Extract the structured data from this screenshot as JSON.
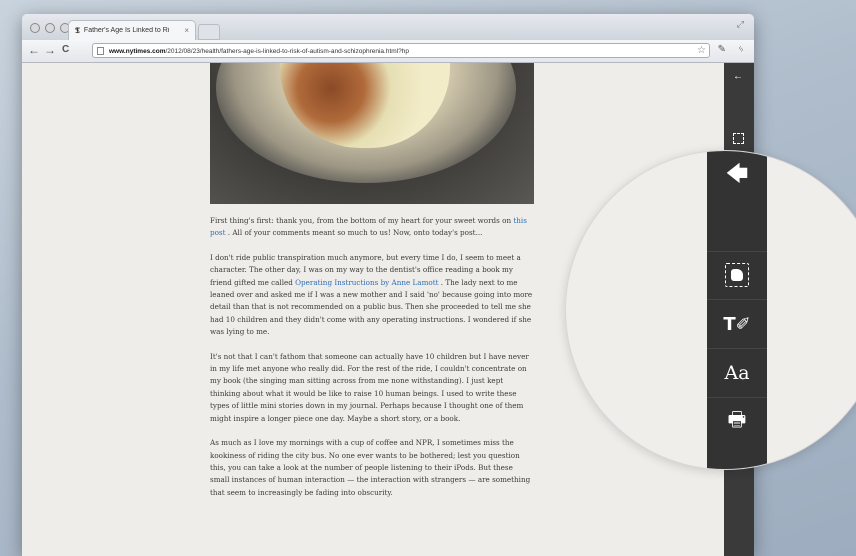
{
  "browser": {
    "tab_title": "Father's Age Is Linked to Ri",
    "tab_favicon": "𝕿",
    "tab_close": "×",
    "url_domain": "www.nytimes.com",
    "url_path": "/2012/08/23/health/fathers-age-is-linked-to-risk-of-autism-and-schizophrenia.html?hp"
  },
  "icons": {
    "back": "←",
    "forward": "→",
    "reload": "C",
    "star": "☆",
    "tools": "✎",
    "wrench": "ᛃ",
    "resize": "⤢"
  },
  "article": {
    "p1_a": "First thing's first: thank you, from the bottom of my heart for your sweet words on ",
    "p1_link": "this post",
    "p1_b": " . All of your comments meant so much to us! Now, onto today's post...",
    "p2_a": "I don't ride public transpiration much anymore, but every time I do, I seem to meet a character. The other day, I was on my way to the dentist's office reading a book my friend gifted me called ",
    "p2_link": "Operating Instructions by Anne Lamott",
    "p2_b": " . The lady next to me leaned over and asked me if I was a new mother and I said 'no' because going into more detail than that is not recommended on a public bus. Then she proceeded to tell me she had 10 children and they didn't come with any operating instructions. I wondered if she was lying to me.",
    "p3": "It's not that I can't fathom that someone can actually have 10 children but I have never in my life met anyone who really did. For the rest of the ride, I couldn't concentrate on my book (the singing man sitting across from me none withstanding). I just kept thinking about what it would be like to raise 10 human beings. I used to write these types of little mini stories down in my journal. Perhaps because I thought one of them might inspire a longer piece one day. Maybe a short story, or a book.",
    "p4": "As much as I love my mornings with a cup of coffee and NPR, I sometimes miss the kookiness of riding the city bus. No one ever wants to be bothered; lest you question this, you can take a look at the number of people listening to their iPods. But these small instances of human interaction — the interaction with strangers — are something that seem to increasingly be fading into obscurity."
  },
  "magnifier": {
    "back_glyph": "🡄",
    "highlight_glyph": "T✐",
    "text_glyph": "Aa",
    "print_glyph": "🖶"
  }
}
